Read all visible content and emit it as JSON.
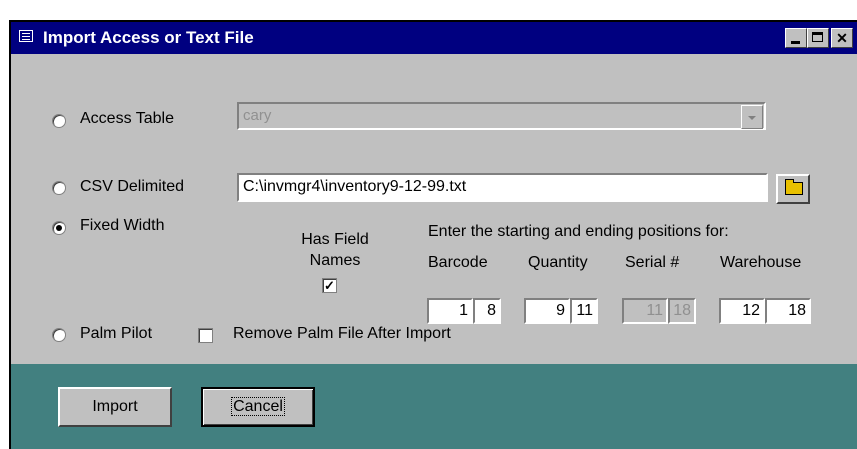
{
  "window": {
    "title": "Import Access or Text File",
    "controls": {
      "minimize": "",
      "maximize": "",
      "close": "✕"
    }
  },
  "options": {
    "access_table": {
      "label": "Access Table",
      "selected": false,
      "table_value": "cary"
    },
    "csv_delimited": {
      "label": "CSV Delimited",
      "selected": false,
      "path_value": "C:\\invmgr4\\inventory9-12-99.txt"
    },
    "fixed_width": {
      "label": "Fixed Width",
      "selected": true
    },
    "palm_pilot": {
      "label": "Palm Pilot",
      "selected": false
    }
  },
  "fixed_width": {
    "has_field_names_line1": "Has Field",
    "has_field_names_line2": "Names",
    "has_field_names_checked": "✓",
    "instruction": "Enter the starting and ending positions for:",
    "fields": [
      {
        "label": "Barcode",
        "start": "1",
        "end": "8"
      },
      {
        "label": "Quantity",
        "start": "9",
        "end": "11"
      },
      {
        "label": "Serial #",
        "start": "11",
        "end": "18"
      },
      {
        "label": "Warehouse",
        "start": "12",
        "end": "18"
      }
    ]
  },
  "palm": {
    "remove_label": "Remove Palm File After Import",
    "remove_checked": ""
  },
  "buttons": {
    "import": "Import",
    "cancel": "Cancel"
  }
}
